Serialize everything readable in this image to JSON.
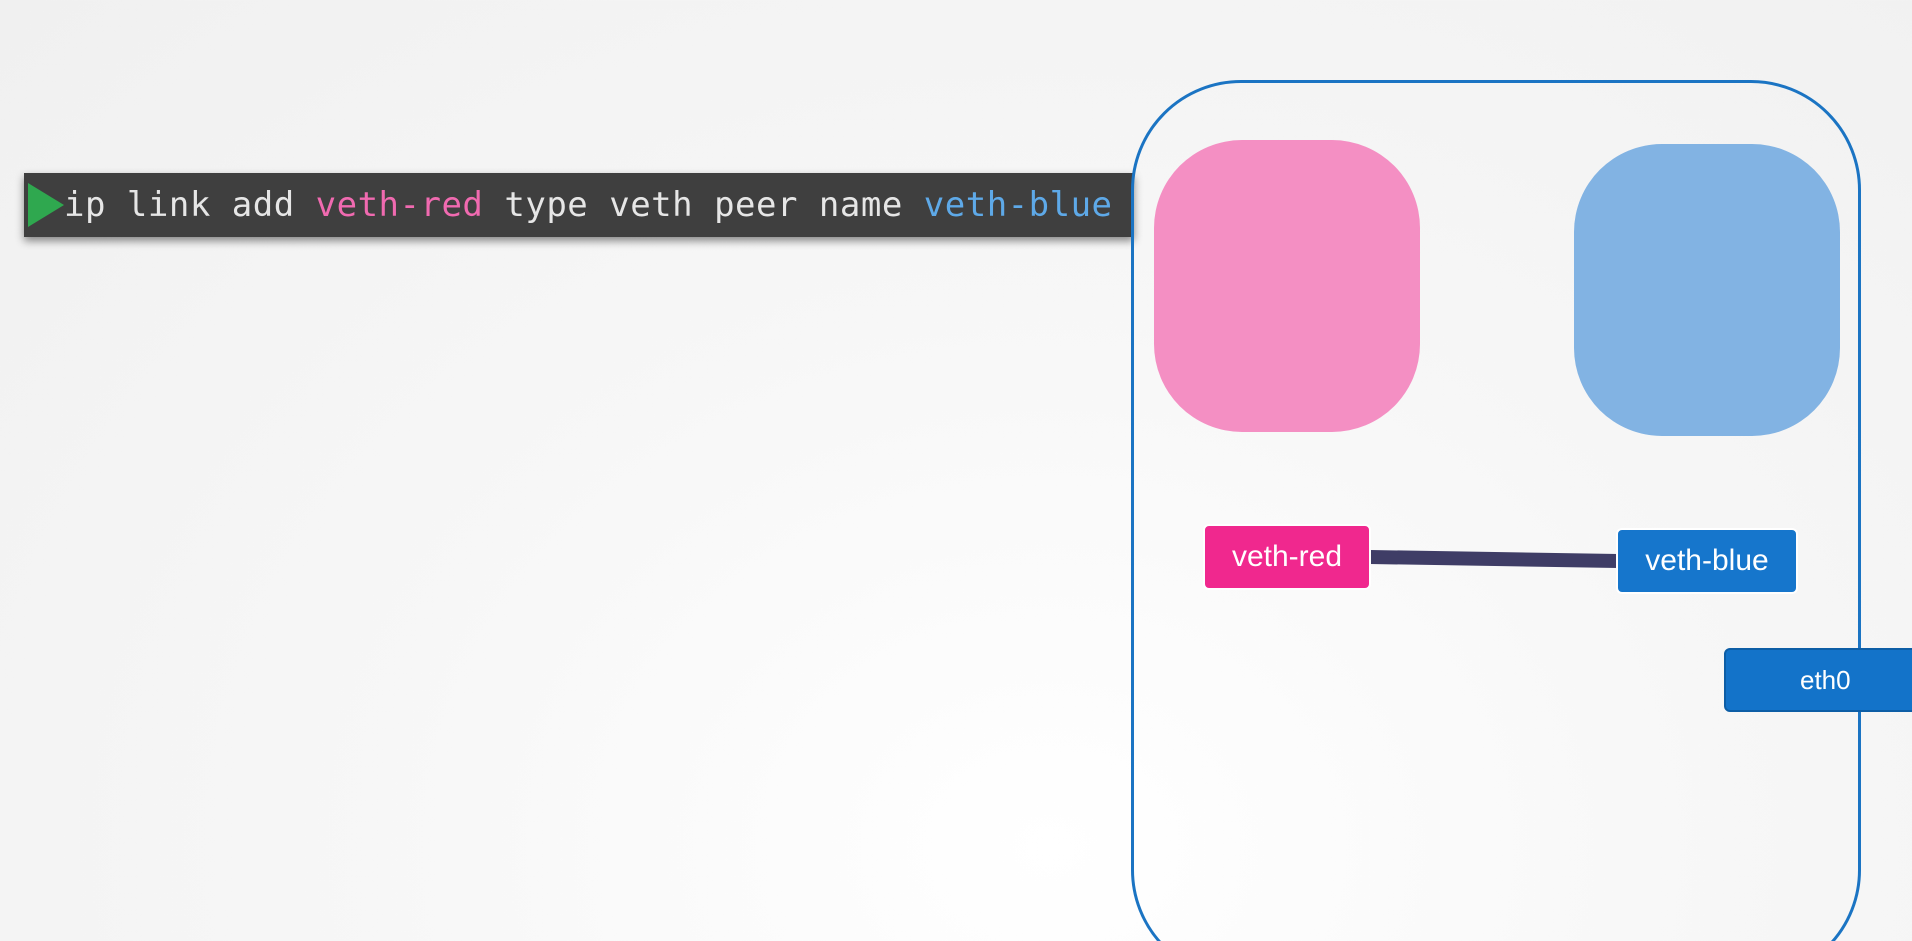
{
  "command": {
    "part1": "ip link add ",
    "name1": "veth-red",
    "part2": " type veth peer name ",
    "name2": "veth-blue"
  },
  "interfaces": {
    "red": "veth-red",
    "blue": "veth-blue",
    "eth0": "eth0"
  },
  "colors": {
    "terminal_bg": "#3f3f3f",
    "prompt": "#2fa84f",
    "red_text": "#f06ab0",
    "blue_text": "#5ea9e8",
    "host_border": "#1b74c3",
    "ns_red": "#f48fc3",
    "ns_blue": "#82b3e3",
    "iface_red": "#f0288e",
    "iface_blue": "#1676cc",
    "link": "#3f3d66"
  },
  "icons": {
    "prompt": "play-triangle-icon"
  }
}
